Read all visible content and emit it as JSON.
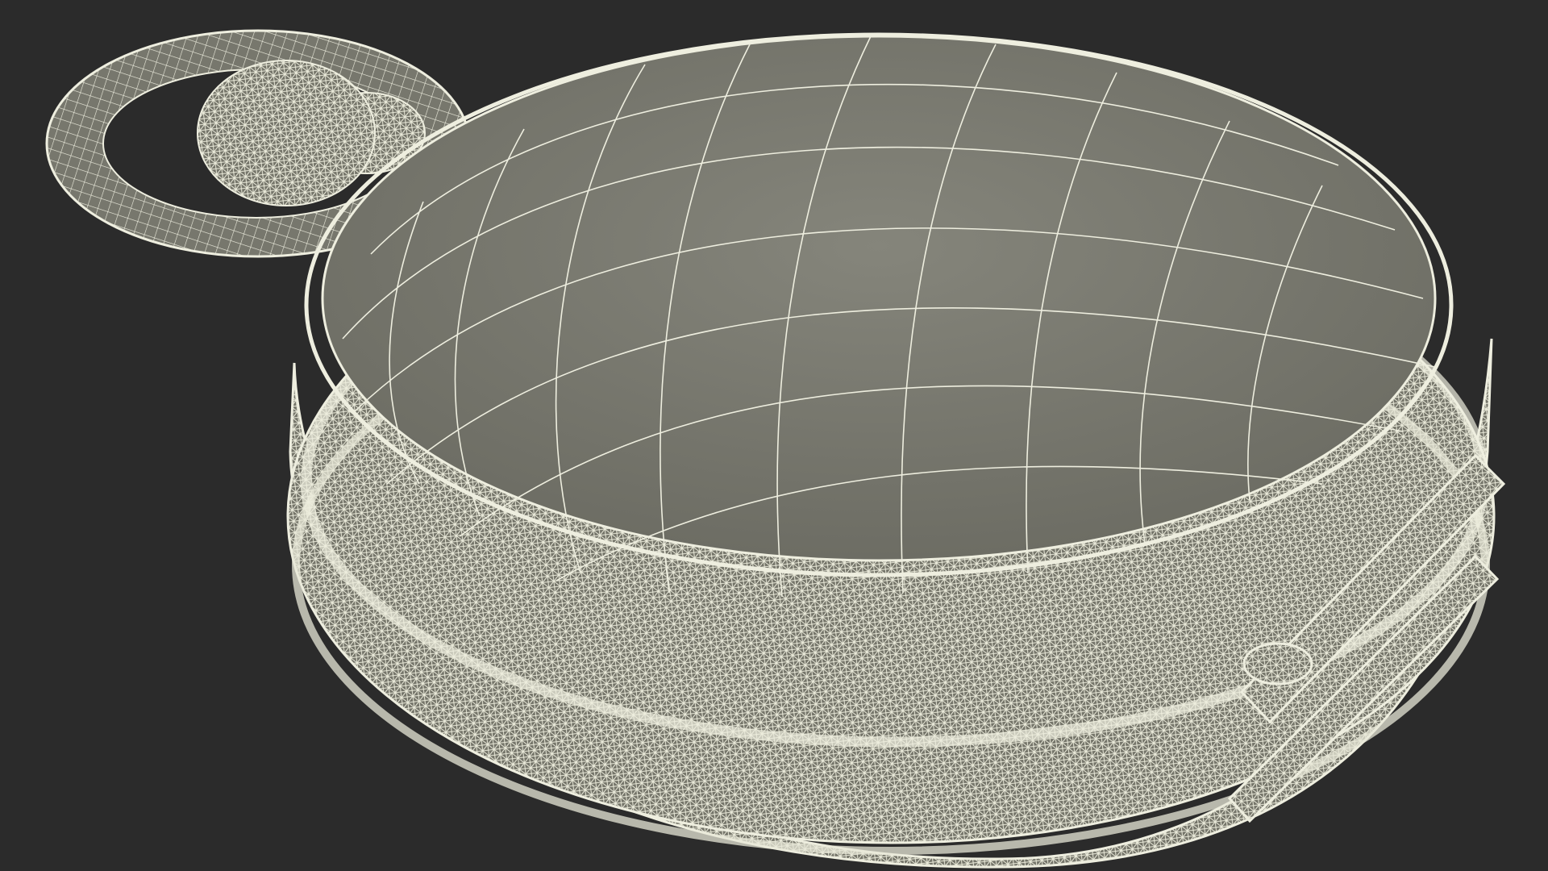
{
  "scene": {
    "background": "#2b2b2b",
    "shell_color": "#7b7b71",
    "shell_shadow": "#5f5f57",
    "wire_color": "#eeeedf",
    "dense_wire_color": "#d8d8c8",
    "objects": [
      "pocket-watch-bow-ring",
      "pocket-watch-crown",
      "pocket-watch-case-top",
      "pocket-watch-case-side",
      "hinge"
    ]
  }
}
